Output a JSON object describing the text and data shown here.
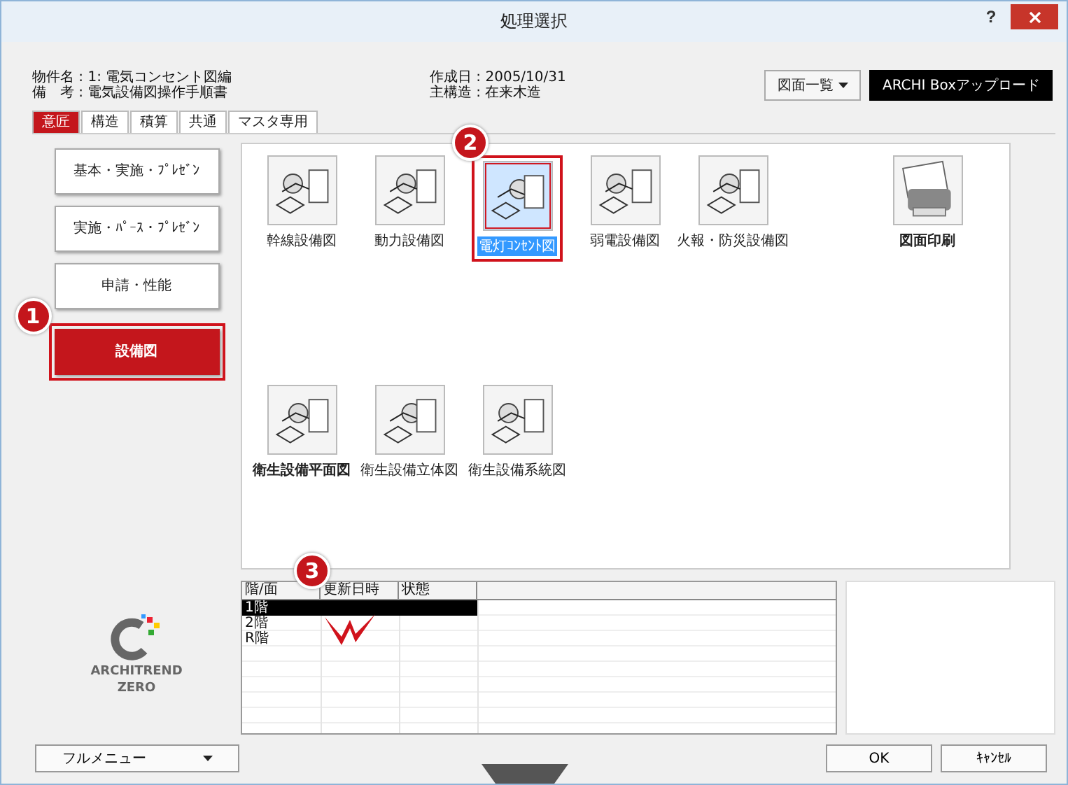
{
  "window": {
    "title": "処理選択",
    "help": "?"
  },
  "info": {
    "left": [
      "物件名 : 1: 電気コンセント図編",
      "備　考 : 電気設備図操作手順書"
    ],
    "right": [
      "作成日 : 2005/10/31",
      "主構造 : 在来木造"
    ]
  },
  "header_buttons": [
    {
      "kind": "dropdown",
      "label": "図面一覧"
    },
    {
      "kind": "dark",
      "label": "ARCHI Boxアップロード"
    }
  ],
  "tabs": [
    {
      "label": "意匠",
      "selected": true
    },
    {
      "label": "構造",
      "selected": false
    },
    {
      "label": "積算",
      "selected": false
    },
    {
      "label": "共通",
      "selected": false
    },
    {
      "label": "マスタ専用",
      "selected": false
    }
  ],
  "categories": [
    {
      "label": "基本・実施・ﾌﾟﾚｾﾞﾝ",
      "selected": false
    },
    {
      "label": "実施・ﾊﾟｰｽ・ﾌﾟﾚｾﾞﾝ",
      "selected": false
    },
    {
      "label": "申請・性能",
      "selected": false
    },
    {
      "label": "設備図",
      "selected": true,
      "callout": "1"
    }
  ],
  "drawing_rows": [
    {
      "items": [
        {
          "label": "幹線設備図",
          "selected": false,
          "bold": false
        },
        {
          "label": "動力設備図",
          "selected": false,
          "bold": false
        },
        {
          "label": "電灯ｺﾝｾﾝﾄ図",
          "selected": true,
          "bold": false,
          "callout": "2"
        },
        {
          "label": "弱電設備図",
          "selected": false,
          "bold": false
        },
        {
          "label": "火報・防災設備図",
          "selected": false,
          "bold": false
        }
      ]
    },
    {
      "items": [
        {
          "label": "衛生設備平面図",
          "selected": false,
          "bold": true
        },
        {
          "label": "衛生設備立体図",
          "selected": false,
          "bold": false
        },
        {
          "label": "衛生設備系統図",
          "selected": false,
          "bold": false
        }
      ]
    }
  ],
  "print": {
    "label": "図面印刷"
  },
  "floors": {
    "callout": "3",
    "columns": [
      "階/面",
      "更新日時",
      "状態"
    ],
    "rows": [
      {
        "floor": "1階",
        "selected": true
      },
      {
        "floor": "2階",
        "selected": false
      },
      {
        "floor": "R階",
        "selected": false
      }
    ]
  },
  "logo": {
    "line1": "ARCHITREND",
    "line2": "ZERO"
  },
  "footer": {
    "menu": "フルメニュー",
    "ok": "OK",
    "cancel": "ｷｬﾝｾﾙ"
  }
}
